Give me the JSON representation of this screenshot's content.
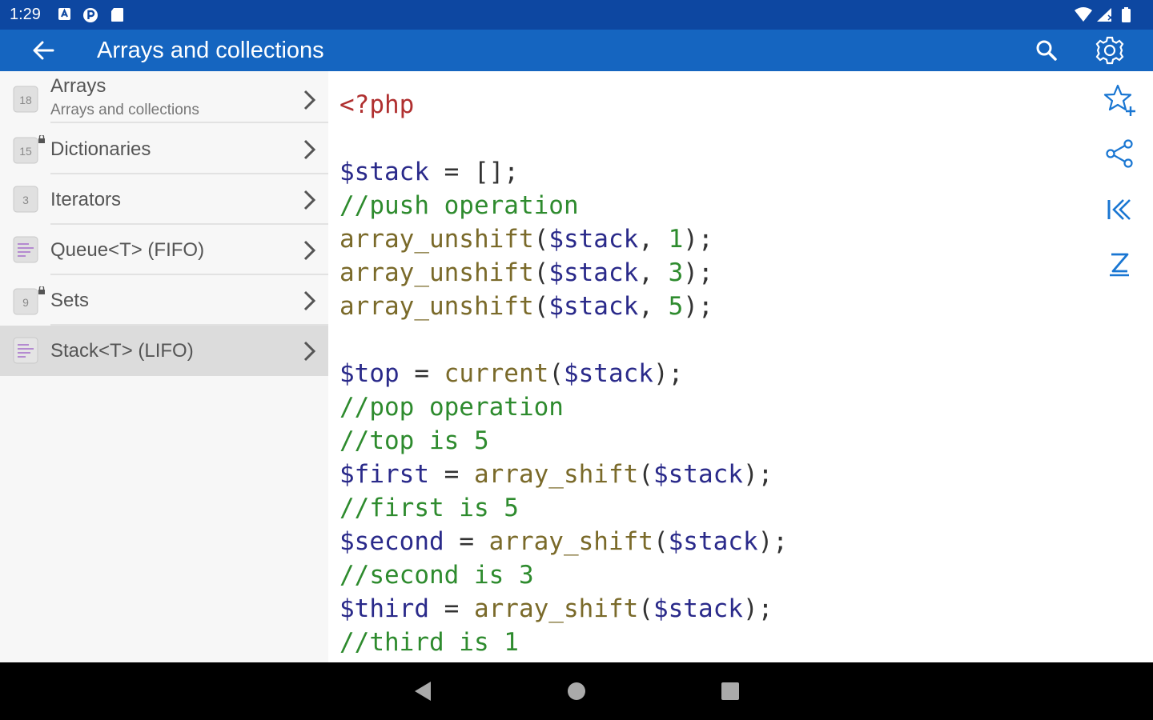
{
  "status": {
    "time": "1:29"
  },
  "appbar": {
    "title": "Arrays and collections"
  },
  "sidebar": {
    "items": [
      {
        "badge": "18",
        "label": "Arrays",
        "sub": "Arrays and collections",
        "locked": false,
        "selected": false
      },
      {
        "badge": "15",
        "label": "Dictionaries",
        "sub": "",
        "locked": true,
        "selected": false
      },
      {
        "badge": "3",
        "label": "Iterators",
        "sub": "",
        "locked": false,
        "selected": false
      },
      {
        "badge": "",
        "label": "Queue<T> (FIFO)",
        "sub": "",
        "locked": false,
        "selected": false
      },
      {
        "badge": "9",
        "label": "Sets",
        "sub": "",
        "locked": true,
        "selected": false
      },
      {
        "badge": "",
        "label": "Stack<T> (LIFO)",
        "sub": "",
        "locked": false,
        "selected": true
      }
    ]
  },
  "code": {
    "lines": [
      [
        [
          "tag",
          "<?php"
        ]
      ],
      [],
      [
        [
          "var",
          "$stack"
        ],
        [
          "pun",
          " = [];"
        ]
      ],
      [
        [
          "cm",
          "//push operation"
        ]
      ],
      [
        [
          "fn",
          "array_unshift"
        ],
        [
          "pun",
          "("
        ],
        [
          "var",
          "$stack"
        ],
        [
          "pun",
          ", "
        ],
        [
          "num",
          "1"
        ],
        [
          "pun",
          ");"
        ]
      ],
      [
        [
          "fn",
          "array_unshift"
        ],
        [
          "pun",
          "("
        ],
        [
          "var",
          "$stack"
        ],
        [
          "pun",
          ", "
        ],
        [
          "num",
          "3"
        ],
        [
          "pun",
          ");"
        ]
      ],
      [
        [
          "fn",
          "array_unshift"
        ],
        [
          "pun",
          "("
        ],
        [
          "var",
          "$stack"
        ],
        [
          "pun",
          ", "
        ],
        [
          "num",
          "5"
        ],
        [
          "pun",
          ");"
        ]
      ],
      [],
      [
        [
          "var",
          "$top"
        ],
        [
          "pun",
          " = "
        ],
        [
          "fn",
          "current"
        ],
        [
          "pun",
          "("
        ],
        [
          "var",
          "$stack"
        ],
        [
          "pun",
          ");"
        ]
      ],
      [
        [
          "cm",
          "//pop operation"
        ]
      ],
      [
        [
          "cm",
          "//top is 5"
        ]
      ],
      [
        [
          "var",
          "$first"
        ],
        [
          "pun",
          " = "
        ],
        [
          "fn",
          "array_shift"
        ],
        [
          "pun",
          "("
        ],
        [
          "var",
          "$stack"
        ],
        [
          "pun",
          ");"
        ]
      ],
      [
        [
          "cm",
          "//first is 5"
        ]
      ],
      [
        [
          "var",
          "$second"
        ],
        [
          "pun",
          " = "
        ],
        [
          "fn",
          "array_shift"
        ],
        [
          "pun",
          "("
        ],
        [
          "var",
          "$stack"
        ],
        [
          "pun",
          ");"
        ]
      ],
      [
        [
          "cm",
          "//second is 3"
        ]
      ],
      [
        [
          "var",
          "$third"
        ],
        [
          "pun",
          " = "
        ],
        [
          "fn",
          "array_shift"
        ],
        [
          "pun",
          "("
        ],
        [
          "var",
          "$stack"
        ],
        [
          "pun",
          ");"
        ]
      ],
      [
        [
          "cm",
          "//third is 1"
        ]
      ]
    ]
  },
  "colors": {
    "statusbar": "#0d47a1",
    "appbar": "#1565c0",
    "accent": "#1976d2"
  },
  "icons": {
    "back": "arrow-left-icon",
    "search": "search-icon",
    "settings": "gear-icon",
    "favorite": "star-plus-icon",
    "share": "share-icon",
    "first": "skip-first-icon",
    "sort": "sort-icon"
  }
}
